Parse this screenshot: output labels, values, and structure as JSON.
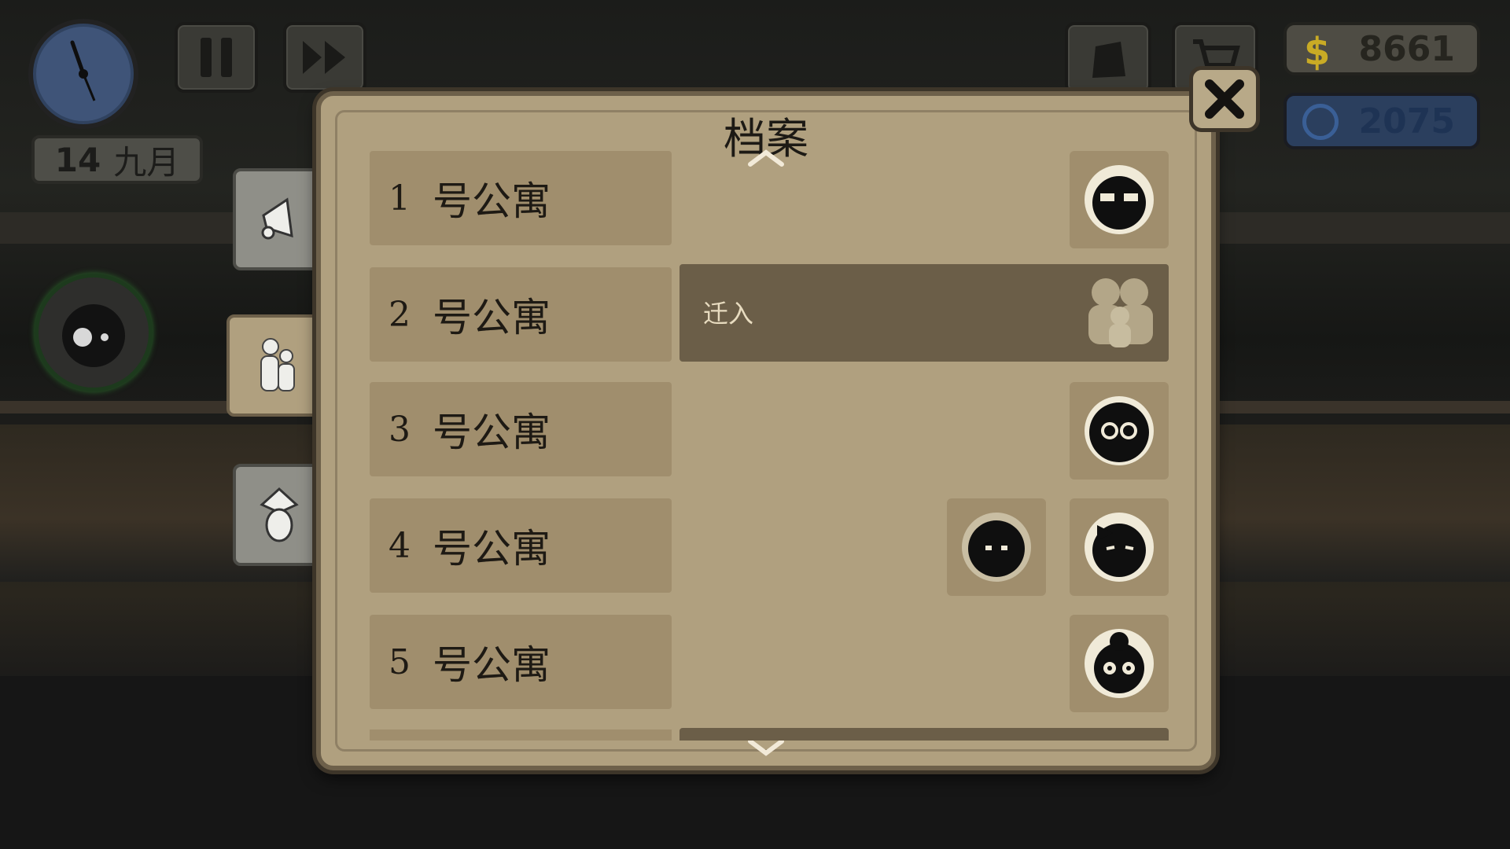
{
  "hud": {
    "date_day": "14",
    "date_month": "九月",
    "money": "8661",
    "reputation": "2075",
    "colors": {
      "money": "#d4b52a",
      "reputation": "#2e5c9a"
    }
  },
  "dialog": {
    "title": "档案",
    "close_icon": "close-icon"
  },
  "side_tabs": [
    {
      "icon": "megaphone-icon",
      "active": false
    },
    {
      "icon": "tenants-icon",
      "active": true
    },
    {
      "icon": "informant-icon",
      "active": false
    }
  ],
  "apartments": [
    {
      "number": "1",
      "label": "号公寓",
      "tenants": [
        "man-with-glasses"
      ]
    },
    {
      "number": "2",
      "label": "号公寓",
      "move_in": "迁入"
    },
    {
      "number": "3",
      "label": "号公寓",
      "tenants": [
        "curly-hair-glasses"
      ]
    },
    {
      "number": "4",
      "label": "号公寓",
      "tenants": [
        "shaggy-child",
        "girl-with-bow"
      ]
    },
    {
      "number": "5",
      "label": "号公寓",
      "tenants": [
        "old-woman-bun"
      ]
    }
  ]
}
